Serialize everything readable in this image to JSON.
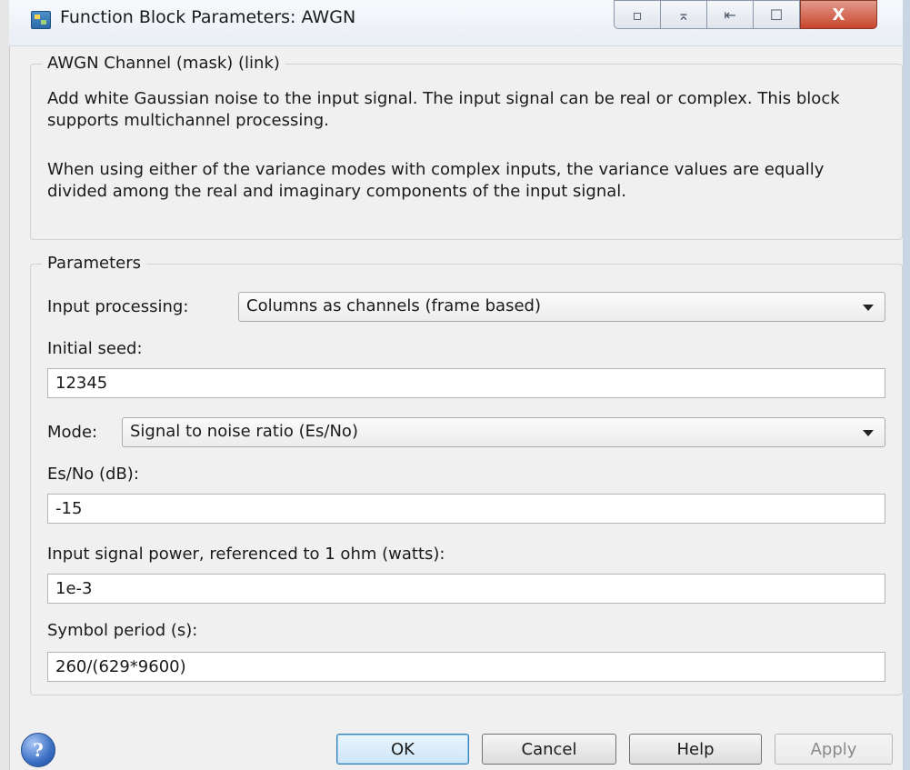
{
  "window": {
    "title": "Function Block Parameters: AWGN",
    "controls": {
      "minimize": "▫",
      "close": "X"
    }
  },
  "description": {
    "group_title": "AWGN Channel (mask) (link)",
    "paragraph1": "Add white Gaussian noise to the input signal. The input signal can be real or complex. This block supports multichannel processing.",
    "paragraph2": "When using either of the variance modes with complex inputs, the variance values are equally divided among the real and imaginary components of the input signal."
  },
  "parameters": {
    "group_title": "Parameters",
    "input_processing": {
      "label": "Input processing:",
      "value": "Columns as channels (frame based)"
    },
    "initial_seed": {
      "label": "Initial seed:",
      "value": "12345"
    },
    "mode": {
      "label": "Mode:",
      "value": "Signal to noise ratio  (Es/No)"
    },
    "esno": {
      "label": "Es/No (dB):",
      "value": "-15"
    },
    "input_signal_power": {
      "label": "Input signal power, referenced to 1 ohm (watts):",
      "value": "1e-3"
    },
    "symbol_period": {
      "label": "Symbol period (s):",
      "value": "260/(629*9600)"
    }
  },
  "buttons": {
    "help_icon": "?",
    "ok": "OK",
    "cancel": "Cancel",
    "help": "Help",
    "apply": "Apply"
  },
  "icons": {
    "app": "simulink-block-icon",
    "help": "help-circle-icon",
    "dropdown": "chevron-down-icon"
  }
}
